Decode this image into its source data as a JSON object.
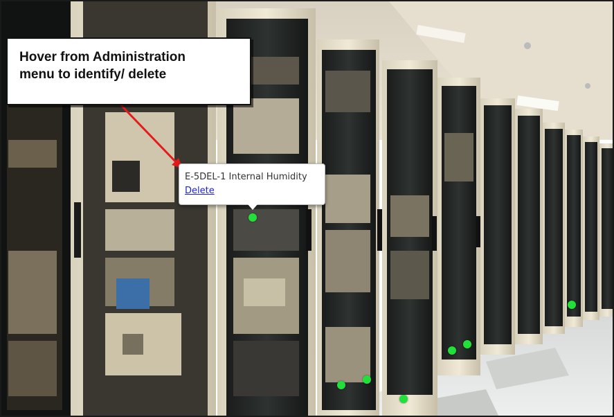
{
  "callout": {
    "line1": "Hover from Administration",
    "line2": "menu to identify/ delete"
  },
  "popup": {
    "sensor_name": "E-5DEL-1 Internal Humidity",
    "delete_link": "Delete"
  },
  "colors": {
    "sensor_dot": "#22e03a",
    "arrow": "#e31b1b",
    "link": "#2222cc"
  },
  "sensors": [
    {
      "name": "E-5DEL-1 Internal Humidity",
      "state": "selected"
    },
    {
      "name": "",
      "state": "normal"
    },
    {
      "name": "",
      "state": "normal"
    },
    {
      "name": "",
      "state": "normal"
    },
    {
      "name": "",
      "state": "normal"
    },
    {
      "name": "",
      "state": "normal"
    },
    {
      "name": "",
      "state": "normal"
    }
  ]
}
